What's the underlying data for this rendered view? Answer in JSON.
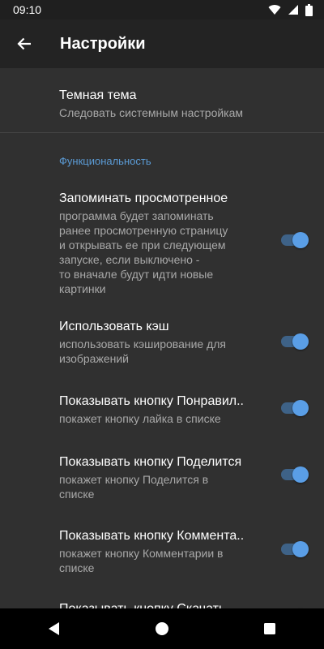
{
  "status_bar": {
    "time": "09:10"
  },
  "app_bar": {
    "title": "Настройки"
  },
  "preferences": [
    {
      "title": "Темная тема",
      "summary": "Следовать системным настройкам"
    },
    {
      "title": "Запоминать просмотренное",
      "summary": "программа будет запоминать\nранее просмотренную страницу\nи открывать ее при следующем\nзапуске, если выключено -\nто вначале будут идти новые\nкартинки",
      "enabled": true
    },
    {
      "title": "Использовать кэш",
      "summary": "использовать кэширование для\nизображений",
      "enabled": true
    },
    {
      "title": "Показывать кнопку Понравил..",
      "summary": "покажет кнопку лайка в списке",
      "enabled": true
    },
    {
      "title": "Показывать кнопку Поделится",
      "summary": "покажет кнопку Поделится в\nсписке",
      "enabled": true
    },
    {
      "title": "Показывать кнопку Коммента..",
      "summary": "покажет кнопку Комментарии в\nсписке",
      "enabled": true
    },
    {
      "title": "Показывать кнопку Скачать",
      "enabled": true
    }
  ],
  "category": {
    "label": "Функциональность"
  },
  "colors": {
    "accent": "#5a9ee6",
    "track": "#3e6287",
    "background": "#303030",
    "app_bar": "#232323",
    "category": "#5b9bd5"
  },
  "icons": {
    "back": "arrow-left-icon",
    "wifi": "wifi-icon",
    "cell": "cell-signal-icon",
    "battery": "battery-icon",
    "nav_back": "triangle-back-icon",
    "nav_home": "circle-home-icon",
    "nav_recents": "square-recents-icon"
  }
}
